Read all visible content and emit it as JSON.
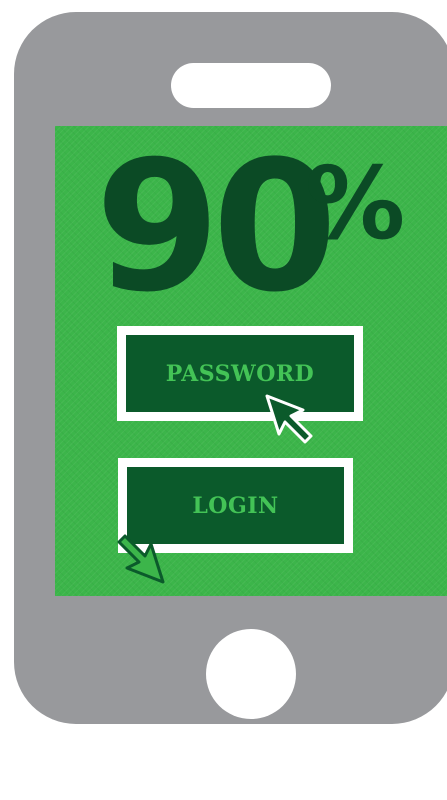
{
  "illustration": {
    "percentage_value": "90",
    "percentage_sign": "%",
    "password_field_label": "PASSWORD",
    "login_button_label": "LOGIN"
  },
  "icons": {
    "cursor": "arrow-cursor-icon"
  },
  "colors": {
    "phone_body": "#98999c",
    "screen_green": "#3cb54a",
    "dark_green": "#0b4a25",
    "field_green": "#0b5a2b",
    "label_green": "#43c356"
  }
}
